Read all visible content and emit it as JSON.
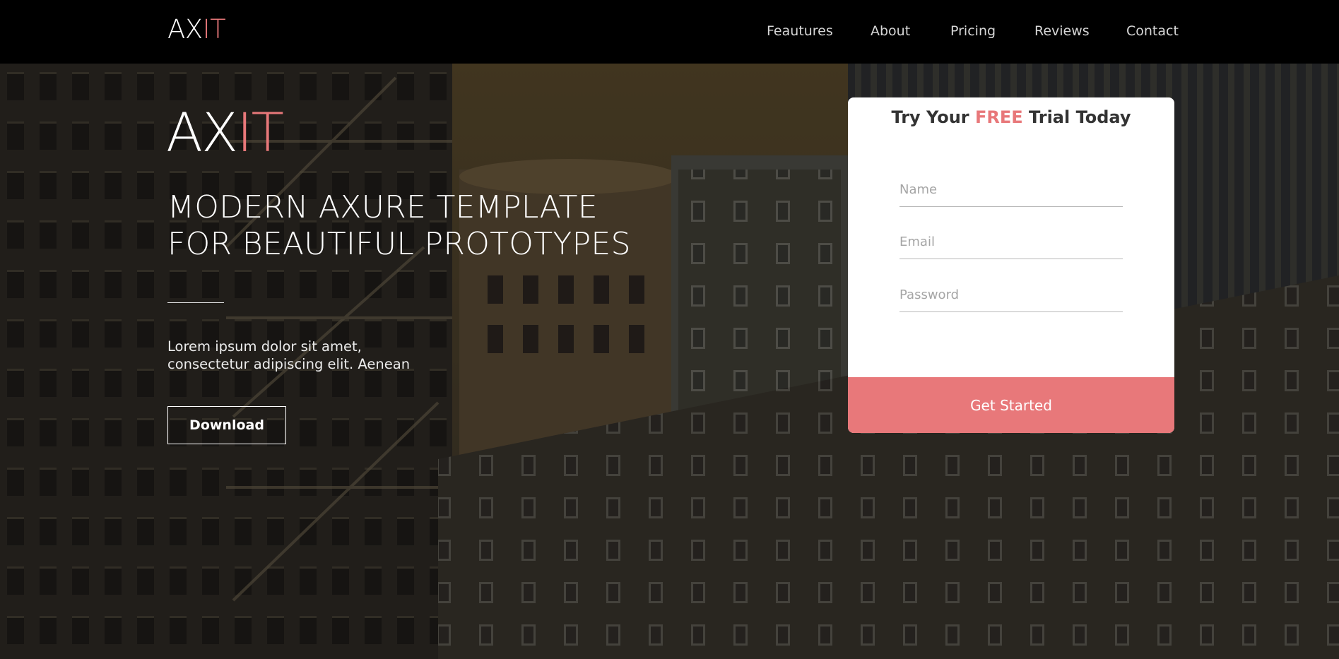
{
  "colors": {
    "accent": "#e8787a",
    "navbar_bg": "#000000",
    "card_bg": "#ffffff"
  },
  "navbar": {
    "logo_main": "AX",
    "logo_accent": "IT",
    "links": [
      {
        "label": "Feautures"
      },
      {
        "label": "About"
      },
      {
        "label": "Pricing"
      },
      {
        "label": "Reviews"
      },
      {
        "label": "Contact"
      }
    ]
  },
  "hero": {
    "title_main": "AX",
    "title_accent": "IT",
    "subtitle_line1": "MODERN AXURE TEMPLATE",
    "subtitle_line2": "FOR BEAUTIFUL PROTOTYPES",
    "body_line1": "Lorem ipsum dolor sit amet,",
    "body_line2": "consectetur adipiscing elit. Aenean",
    "download_label": "Download"
  },
  "signup": {
    "title_pre": "Try Your ",
    "title_accent": "FREE",
    "title_post": " Trial Today",
    "name_placeholder": "Name",
    "email_placeholder": "Email",
    "password_placeholder": "Password",
    "submit_label": "Get Started"
  }
}
